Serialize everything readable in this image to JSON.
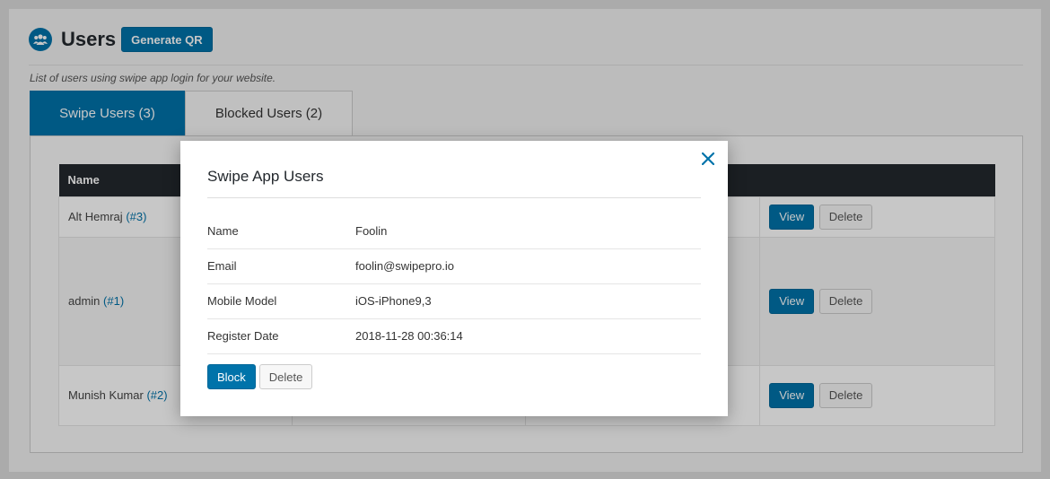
{
  "header": {
    "title": "Users",
    "generate_qr_label": "Generate QR",
    "description": "List of users using swipe app login for your website."
  },
  "tabs": [
    {
      "label": "Swipe Users (3)",
      "active": true
    },
    {
      "label": "Blocked Users (2)",
      "active": false
    }
  ],
  "table": {
    "columns": [
      "Name",
      "",
      "",
      ""
    ],
    "rows": [
      {
        "name": "Alt Hemraj",
        "id": "(#3)",
        "view_label": "View",
        "delete_label": "Delete"
      },
      {
        "name": "admin",
        "id": "(#1)",
        "view_label": "View",
        "delete_label": "Delete"
      },
      {
        "name": "Munish Kumar",
        "id": "(#2)",
        "view_label": "View",
        "delete_label": "Delete"
      }
    ]
  },
  "modal": {
    "title": "Swipe App Users",
    "close_icon": "close-icon",
    "fields": [
      {
        "label": "Name",
        "value": "Foolin"
      },
      {
        "label": "Email",
        "value": "foolin@swipepro.io"
      },
      {
        "label": "Mobile Model",
        "value": "iOS-iPhone9,3"
      },
      {
        "label": "Register Date",
        "value": "2018-11-28 00:36:14"
      }
    ],
    "block_label": "Block",
    "delete_label": "Delete"
  },
  "colors": {
    "accent": "#0073aa",
    "header_dark": "#23282d"
  }
}
